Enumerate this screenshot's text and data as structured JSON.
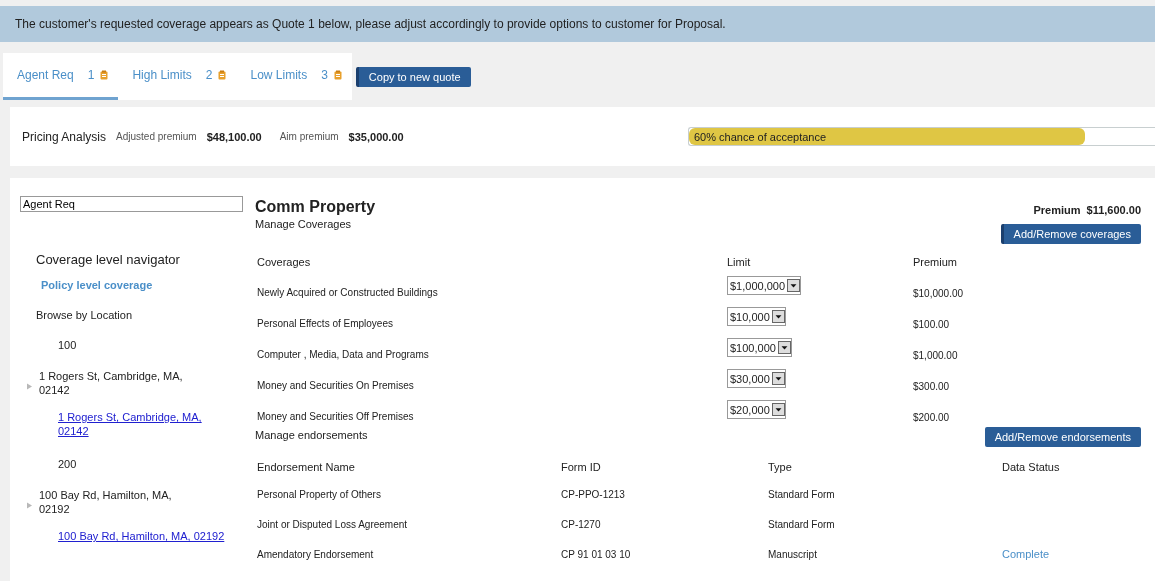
{
  "banner": "The customer's requested coverage appears as Quote 1 below, please adjust accordingly to provide options to customer for Proposal.",
  "tabs": [
    {
      "label": "Agent Req",
      "number": "1",
      "selected": true
    },
    {
      "label": "High Limits",
      "number": "2",
      "selected": false
    },
    {
      "label": "Low Limits",
      "number": "3",
      "selected": false
    }
  ],
  "copy_button": "Copy to new quote",
  "pricing": {
    "title": "Pricing Analysis",
    "adjusted_label": "Adjusted premium",
    "adjusted_value": "$48,100.00",
    "aim_label": "Aim premium",
    "aim_value": "$35,000.00",
    "acceptance": {
      "label": "60% chance of acceptance",
      "level": 0.85
    }
  },
  "quote_name": "Agent Req",
  "navigator": {
    "title": "Coverage level navigator",
    "policy_link": "Policy level coverage",
    "browse_label": "Browse by Location",
    "locations": [
      {
        "number": "100",
        "address": "1 Rogers St, Cambridge, MA, 02142",
        "expanded": false,
        "link": "1 Rogers St, Cambridge, MA, 02142"
      },
      {
        "number": "200",
        "address": "100 Bay Rd, Hamilton, MA, 02192",
        "expanded": false,
        "link": "100 Bay Rd, Hamilton, MA, 02192"
      }
    ]
  },
  "line": {
    "title": "Comm Property",
    "premium_label": "Premium",
    "premium_value": "$11,600.00"
  },
  "coverages": {
    "title": "Manage Coverages",
    "button": "Add/Remove coverages",
    "columns": [
      "Coverages",
      "Limit",
      "Premium"
    ],
    "rows": [
      {
        "name": "Newly Acquired or Constructed Buildings",
        "limit": "$1,000,000",
        "premium": "$10,000.00"
      },
      {
        "name": "Personal Effects of Employees",
        "limit": "$10,000",
        "premium": "$100.00"
      },
      {
        "name": "Computer , Media, Data and Programs",
        "limit": "$100,000",
        "premium": "$1,000.00"
      },
      {
        "name": "Money and Securities On Premises",
        "limit": "$30,000",
        "premium": "$300.00"
      },
      {
        "name": "Money and Securities Off Premises",
        "limit": "$20,000",
        "premium": "$200.00"
      }
    ]
  },
  "endorsements": {
    "title": "Manage endorsements",
    "button": "Add/Remove endorsements",
    "columns": [
      "Endorsement Name",
      "Form ID",
      "Type",
      "Data Status"
    ],
    "rows": [
      {
        "name": "Personal Property of Others",
        "form_id": "CP-PPO-1213",
        "type": "Standard Form"
      },
      {
        "name": "Joint or Disputed Loss Agreement",
        "form_id": "CP-1270",
        "type": "Standard Form"
      },
      {
        "name": "Amendatory Endorsement",
        "form_id": "CP 91 01 03 10",
        "type": "Manuscript",
        "status": "Complete"
      }
    ]
  }
}
